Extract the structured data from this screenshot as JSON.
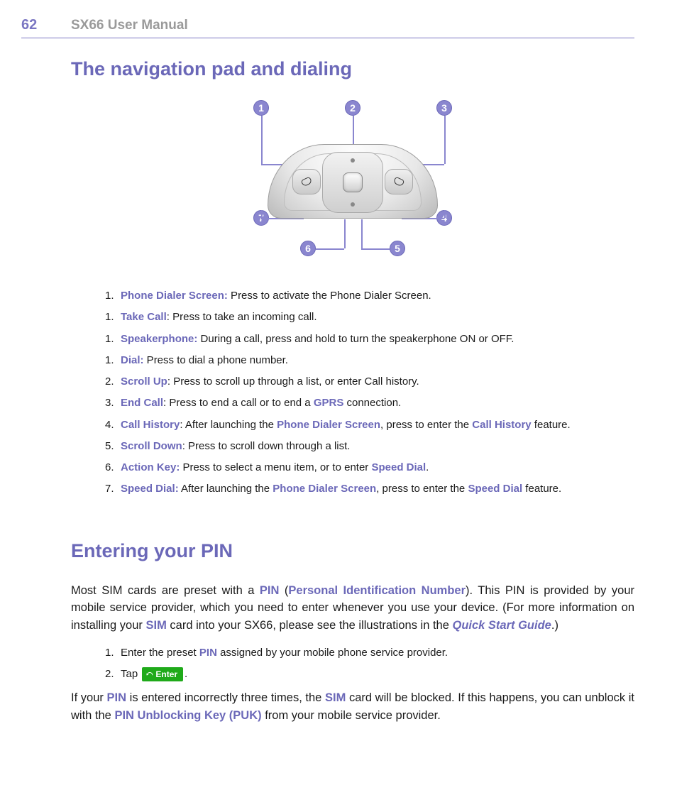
{
  "header": {
    "page_number": "62",
    "manual_title": "SX66 User Manual"
  },
  "section1": {
    "title": "The navigation pad and dialing",
    "callouts": {
      "c1": "1",
      "c2": "2",
      "c3": "3",
      "c4": "4",
      "c5": "5",
      "c6": "6",
      "c7": "7"
    },
    "list": [
      {
        "num": "1.",
        "term": "Phone Dialer Screen:",
        "rest": " Press to activate the Phone Dialer Screen."
      },
      {
        "num": "1.",
        "term": "Take Call",
        "rest": ": Press to take an incoming call."
      },
      {
        "num": "1.",
        "term": "Speakerphone:",
        "rest": " During a call, press and hold to turn the speakerphone ON or OFF."
      },
      {
        "num": "1.",
        "term": "Dial:",
        "rest": " Press to dial a phone number."
      },
      {
        "num": "2.",
        "term": "Scroll Up",
        "rest": ": Press to scroll up through a list, or enter Call history."
      },
      {
        "num": "3.",
        "term": "End Call",
        "rest": ": Press to end a call or to end a ",
        "kw2": "GPRS",
        "rest2": " connection."
      },
      {
        "num": "4.",
        "term": "Call History",
        "rest": ": After launching the ",
        "kw2": "Phone Dialer Screen",
        "rest2": ", press to enter the ",
        "kw3": "Call History",
        "rest3": " feature."
      },
      {
        "num": "5.",
        "term": "Scroll Down",
        "rest": ": Press to scroll down through a list."
      },
      {
        "num": "6.",
        "term": "Action Key:",
        "rest": " Press to select a menu item, or to enter ",
        "kw2": "Speed Dial",
        "rest2": "."
      },
      {
        "num": "7.",
        "term": "Speed Dial:",
        "rest": " After launching the ",
        "kw2": "Phone Dialer Screen",
        "rest2": ", press to enter the ",
        "kw3": "Speed Dial",
        "rest3": " feature."
      }
    ]
  },
  "section2": {
    "title": "Entering your PIN",
    "para1": {
      "t0": "Most SIM cards are preset with a ",
      "kw1": "PIN",
      "t1": " (",
      "kw2": "Personal Identification Number",
      "t2": "). This PIN is provided by your mobile service provider, which you need to enter whenever you use your device. (For more information on installing your ",
      "kw3": "SIM",
      "t3": " card into your SX66, please see the illustrations in the ",
      "kw4": "Quick Start Guide",
      "t4": ".)"
    },
    "steps": [
      {
        "num": "1.",
        "t0": "Enter the preset ",
        "kw1": "PIN",
        "t1": " assigned by your mobile phone service provider."
      },
      {
        "num": "2.",
        "t0": "Tap ",
        "btn": "Enter",
        "t1": "."
      }
    ],
    "para2": {
      "t0": "If your ",
      "kw1": "PIN",
      "t1": " is entered incorrectly three times, the ",
      "kw2": "SIM",
      "t2": " card will be blocked. If this happens, you can unblock it with the ",
      "kw3": "PIN Unblocking Key (PUK)",
      "t3": " from your mobile service provider."
    }
  }
}
